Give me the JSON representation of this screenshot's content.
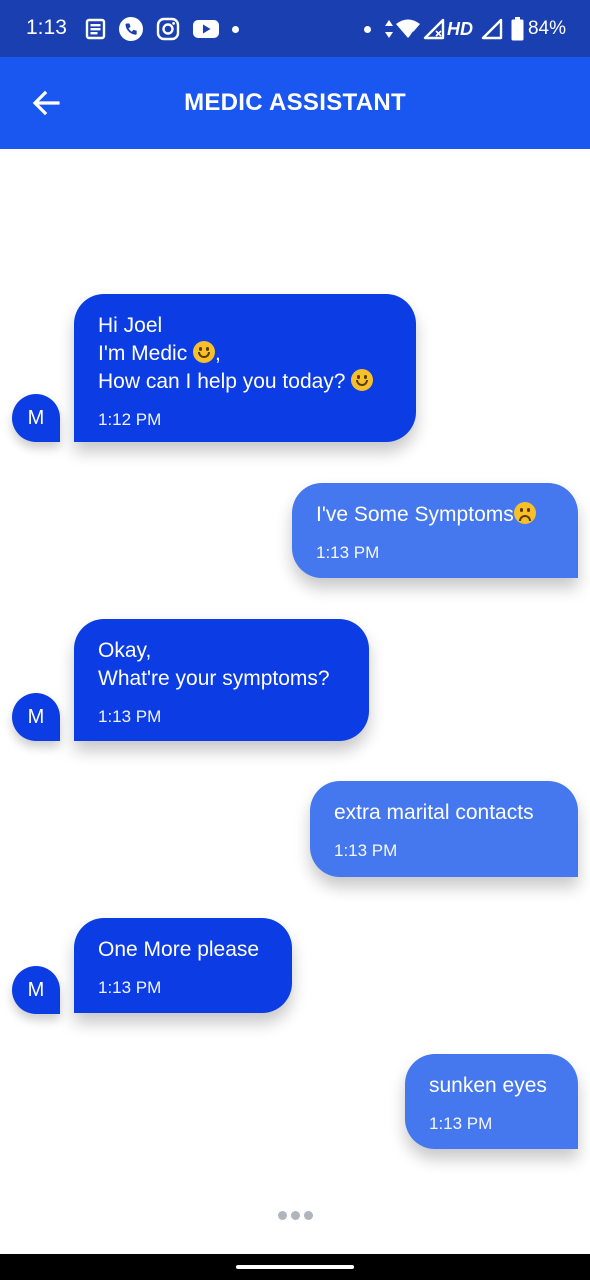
{
  "status_bar": {
    "time": "1:13",
    "network_label": "HD",
    "battery": "84%",
    "icons": [
      "news-icon",
      "phone-icon",
      "instagram-icon",
      "youtube-icon",
      "dot-icon",
      "dot-icon",
      "data-arrows-icon",
      "wifi-icon",
      "signal-icon",
      "signal-icon",
      "battery-icon"
    ]
  },
  "app_bar": {
    "title": "MEDIC ASSISTANT",
    "back_icon": "arrow-left-icon"
  },
  "chat": {
    "avatar_letter": "M",
    "messages": [
      {
        "sender": "bot",
        "text": "Hi Joel\nI'm Medic",
        "text2": ",",
        "text3": "How can I help you today?",
        "time": "1:12 PM"
      },
      {
        "sender": "user",
        "text": "I've Some Symptoms",
        "time": "1:13 PM"
      },
      {
        "sender": "bot",
        "text": "Okay,\nWhat're your symptoms?",
        "time": "1:13 PM"
      },
      {
        "sender": "user",
        "text": "extra marital contacts",
        "time": "1:13 PM"
      },
      {
        "sender": "bot",
        "text": "One More please",
        "time": "1:13 PM"
      },
      {
        "sender": "user",
        "text": "sunken eyes",
        "time": "1:13 PM"
      }
    ]
  },
  "colors": {
    "status_bar": "#1a3fb0",
    "app_bar": "#1a56f0",
    "bot_bubble": "#0c3ce4",
    "user_bubble": "#4577ee"
  }
}
